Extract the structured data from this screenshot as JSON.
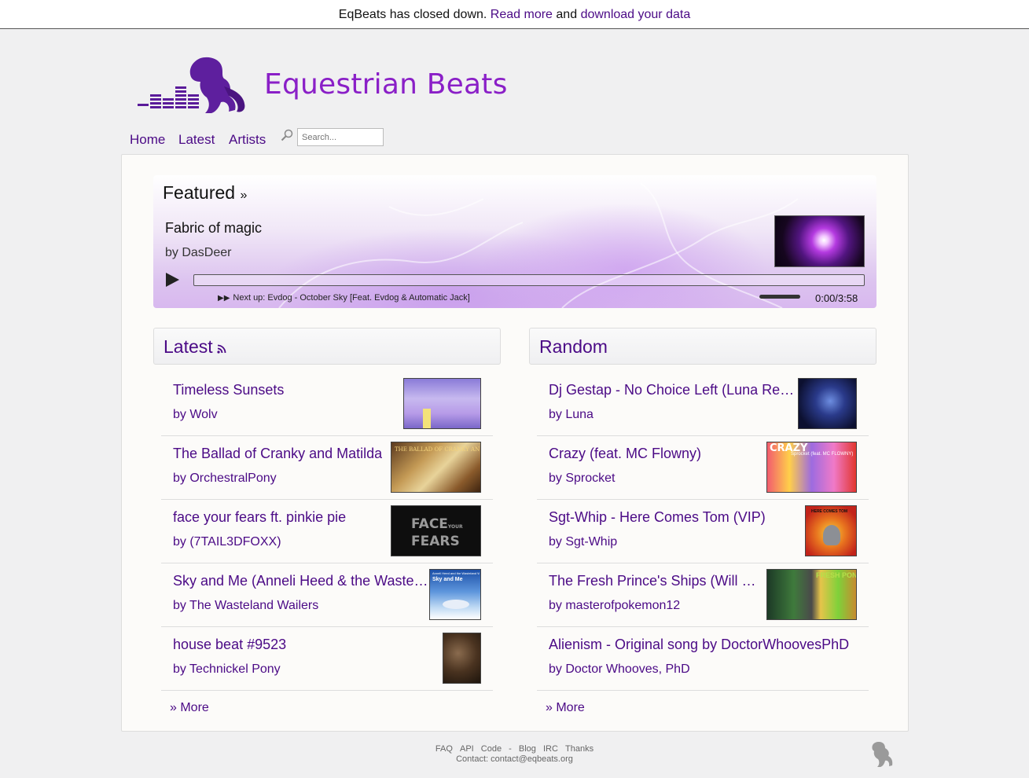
{
  "notice": {
    "text": "EqBeats has closed down.",
    "read_more": "Read more",
    "and": "and",
    "download": "download your data"
  },
  "site": {
    "title": "Equestrian Beats"
  },
  "nav": {
    "items": [
      "Home",
      "Latest",
      "Artists"
    ],
    "search_placeholder": "Search..."
  },
  "featured": {
    "heading": "Featured",
    "heading_suffix": "»",
    "title": "Fabric of magic",
    "artist": "by DasDeer",
    "next_up_icon": "▶▶",
    "next_up": "Next up: Evdog - October Sky [Feat. Evdog & Automatic Jack]",
    "time": "0:00/3:58"
  },
  "latest": {
    "heading": "Latest",
    "items": [
      {
        "title": "Timeless Sunsets",
        "artist": "by Wolv"
      },
      {
        "title": "The Ballad of Cranky and Matilda",
        "artist": "by OrchestralPony"
      },
      {
        "title": "face your fears ft. pinkie pie",
        "artist": "by (7TAIL3DFOXX)"
      },
      {
        "title": "Sky and Me (Anneli Heed & the Wasteland Wailers)",
        "artist": "by The Wasteland Wailers"
      },
      {
        "title": "house beat #9523",
        "artist": "by Technickel Pony"
      }
    ],
    "more": "» More"
  },
  "random": {
    "heading": "Random",
    "items": [
      {
        "title": "Dj Gestap - No Choice Left (Luna Remix)",
        "artist": "by Luna"
      },
      {
        "title": "Crazy (feat. MC Flowny)",
        "artist": "by Sprocket"
      },
      {
        "title": "Sgt-Whip - Here Comes Tom (VIP)",
        "artist": "by Sgt-Whip"
      },
      {
        "title": "The Fresh Prince's Ships (Will Smith)",
        "artist": "by masterofpokemon12"
      },
      {
        "title": "Alienism - Original song by DoctorWhoovesPhD",
        "artist": "by Doctor Whooves, PhD"
      }
    ],
    "more": "» More"
  },
  "thumb_text": {
    "ballad": "THE BALLAD OF CRANKY AND MATILDA",
    "fears_1": "FACE",
    "fears_small": "YOUR",
    "fears_2": "FEARS",
    "sky_small": "Anneli Heed and the Wasteland Wailers",
    "sky_title": "Sky and Me",
    "crazy": "CRAZY",
    "crazy_sub": "Sprocket (feat. MC FLOWNY)",
    "tom": "HERE COMES TOM",
    "fresh": "FRESH PONIES"
  },
  "footer": {
    "links": [
      "FAQ",
      "API",
      "Code",
      "-",
      "Blog",
      "IRC",
      "Thanks"
    ],
    "contact": "Contact: contact@eqbeats.org"
  },
  "colors": {
    "accent": "#8a1fc7",
    "link": "#4b0a86",
    "background": "#f0f0f1"
  }
}
